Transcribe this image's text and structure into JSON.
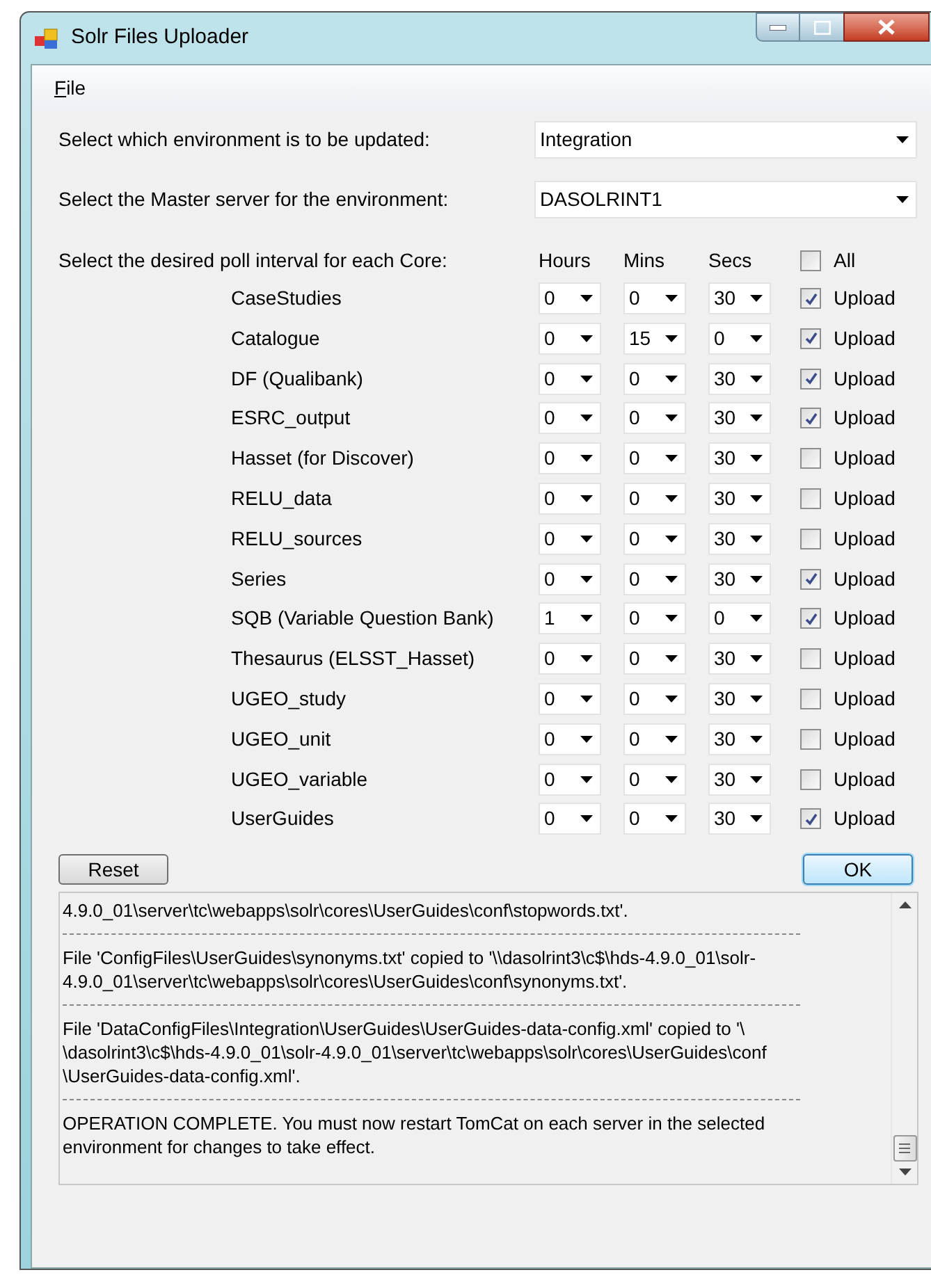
{
  "window": {
    "title": "Solr Files Uploader"
  },
  "menu": [
    {
      "label": "File"
    }
  ],
  "environment": {
    "label": "Select which environment is to be updated:",
    "value": "Integration"
  },
  "master_server": {
    "label": "Select the Master server for the environment:",
    "value": "DASOLRINT1"
  },
  "poll": {
    "label": "Select the desired poll interval for each Core:",
    "columns": [
      "Hours",
      "Mins",
      "Secs"
    ],
    "all": {
      "label": "All",
      "checked": false
    }
  },
  "cores": [
    {
      "name": "CaseStudies",
      "hours": "0",
      "mins": "0",
      "secs": "30",
      "upload_label": "Upload",
      "checked": true
    },
    {
      "name": "Catalogue",
      "hours": "0",
      "mins": "15",
      "secs": "0",
      "upload_label": "Upload",
      "checked": true
    },
    {
      "name": "DF (Qualibank)",
      "hours": "0",
      "mins": "0",
      "secs": "30",
      "upload_label": "Upload",
      "checked": true
    },
    {
      "name": "ESRC_output",
      "hours": "0",
      "mins": "0",
      "secs": "30",
      "upload_label": "Upload",
      "checked": true
    },
    {
      "name": "Hasset (for Discover)",
      "hours": "0",
      "mins": "0",
      "secs": "30",
      "upload_label": "Upload",
      "checked": false
    },
    {
      "name": "RELU_data",
      "hours": "0",
      "mins": "0",
      "secs": "30",
      "upload_label": "Upload",
      "checked": false
    },
    {
      "name": "RELU_sources",
      "hours": "0",
      "mins": "0",
      "secs": "30",
      "upload_label": "Upload",
      "checked": false
    },
    {
      "name": "Series",
      "hours": "0",
      "mins": "0",
      "secs": "30",
      "upload_label": "Upload",
      "checked": true
    },
    {
      "name": "SQB (Variable Question Bank)",
      "hours": "1",
      "mins": "0",
      "secs": "0",
      "upload_label": "Upload",
      "checked": true
    },
    {
      "name": "Thesaurus (ELSST_Hasset)",
      "hours": "0",
      "mins": "0",
      "secs": "30",
      "upload_label": "Upload",
      "checked": false
    },
    {
      "name": "UGEO_study",
      "hours": "0",
      "mins": "0",
      "secs": "30",
      "upload_label": "Upload",
      "checked": false
    },
    {
      "name": "UGEO_unit",
      "hours": "0",
      "mins": "0",
      "secs": "30",
      "upload_label": "Upload",
      "checked": false
    },
    {
      "name": "UGEO_variable",
      "hours": "0",
      "mins": "0",
      "secs": "30",
      "upload_label": "Upload",
      "checked": false
    },
    {
      "name": "UserGuides",
      "hours": "0",
      "mins": "0",
      "secs": "30",
      "upload_label": "Upload",
      "checked": true
    }
  ],
  "buttons": {
    "reset": "Reset",
    "ok": "OK"
  },
  "log": [
    {
      "kind": "text",
      "text": "4.9.0_01\\server\\tc\\webapps\\solr\\cores\\UserGuides\\conf\\stopwords.txt'."
    },
    {
      "kind": "separator"
    },
    {
      "kind": "text",
      "text": "File 'ConfigFiles\\UserGuides\\synonyms.txt' copied to '\\\\dasolrint3\\c$\\hds-4.9.0_01\\solr-"
    },
    {
      "kind": "text",
      "text": "4.9.0_01\\server\\tc\\webapps\\solr\\cores\\UserGuides\\conf\\synonyms.txt'."
    },
    {
      "kind": "separator"
    },
    {
      "kind": "text",
      "text": "File 'DataConfigFiles\\Integration\\UserGuides\\UserGuides-data-config.xml' copied to '\\"
    },
    {
      "kind": "text",
      "text": "\\dasolrint3\\c$\\hds-4.9.0_01\\solr-4.9.0_01\\server\\tc\\webapps\\solr\\cores\\UserGuides\\conf"
    },
    {
      "kind": "text",
      "text": "\\UserGuides-data-config.xml'."
    },
    {
      "kind": "separator"
    },
    {
      "kind": "text",
      "text": "OPERATION COMPLETE. You must now restart TomCat on each server in the selected"
    },
    {
      "kind": "text",
      "text": "environment for changes to take effect."
    }
  ]
}
